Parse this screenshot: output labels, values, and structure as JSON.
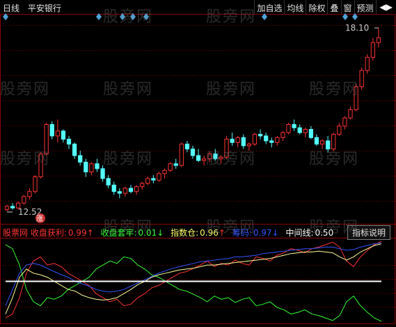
{
  "header": {
    "period": "日线",
    "stock_name": "平安银行"
  },
  "toolbar": {
    "buttons": [
      "加自选",
      "均线",
      "除权",
      "叠",
      "窗",
      "预测"
    ],
    "nav_icon": "◀▶"
  },
  "price_labels": {
    "high": "18.10",
    "low": "12.52",
    "rise_badge": "涨"
  },
  "indicator": {
    "prefix": "股票网 收盘获利:",
    "profit_value": "0.99",
    "profit_arrow": "↑",
    "trap_label": "收盘套牢:",
    "trap_value": "0.01",
    "trap_arrow": "↓",
    "index_label": "指数仓:",
    "index_value": "0.96",
    "index_arrow": "↑",
    "fund_label": "筹码:",
    "fund_value": "0.97",
    "fund_arrow": "↓",
    "mid_label": "中间线:",
    "mid_value": "0.50",
    "explain_button": "指标说明"
  },
  "watermark_text": "股旁网",
  "colors": {
    "up": "#ff3333",
    "down": "#54ffff",
    "grid": "#8b0000",
    "diamond": "#4fa3d9"
  },
  "chart_data": {
    "type": "candlestick",
    "y_range_main": [
      12.52,
      18.1
    ],
    "y_range_indicator": [
      0,
      1
    ],
    "candles": [
      [
        12.55,
        12.7,
        12.5,
        12.65
      ],
      [
        12.65,
        12.75,
        12.55,
        12.6
      ],
      [
        12.6,
        12.8,
        12.55,
        12.75
      ],
      [
        12.75,
        13.0,
        12.7,
        12.95
      ],
      [
        12.95,
        13.2,
        12.85,
        13.1
      ],
      [
        13.1,
        13.6,
        13.05,
        13.55
      ],
      [
        13.55,
        14.3,
        13.5,
        14.25
      ],
      [
        14.25,
        15.2,
        14.2,
        15.15
      ],
      [
        15.15,
        15.25,
        14.7,
        14.8
      ],
      [
        14.8,
        15.3,
        14.6,
        14.95
      ],
      [
        14.95,
        15.0,
        14.6,
        14.7
      ],
      [
        14.7,
        14.8,
        14.4,
        14.55
      ],
      [
        14.55,
        14.6,
        14.1,
        14.2
      ],
      [
        14.2,
        14.35,
        13.9,
        14.0
      ],
      [
        14.0,
        14.1,
        13.55,
        13.7
      ],
      [
        13.7,
        14.0,
        13.6,
        13.95
      ],
      [
        13.95,
        14.1,
        13.7,
        13.8
      ],
      [
        13.8,
        13.9,
        13.4,
        13.5
      ],
      [
        13.5,
        13.6,
        13.2,
        13.3
      ],
      [
        13.3,
        13.4,
        13.0,
        13.1
      ],
      [
        13.1,
        13.2,
        12.9,
        13.05
      ],
      [
        13.05,
        13.25,
        12.95,
        13.2
      ],
      [
        13.2,
        13.3,
        13.05,
        13.1
      ],
      [
        13.1,
        13.3,
        13.0,
        13.25
      ],
      [
        13.25,
        13.4,
        13.15,
        13.35
      ],
      [
        13.35,
        13.55,
        13.3,
        13.5
      ],
      [
        13.5,
        13.6,
        13.35,
        13.45
      ],
      [
        13.45,
        13.7,
        13.4,
        13.65
      ],
      [
        13.65,
        13.8,
        13.5,
        13.75
      ],
      [
        13.75,
        14.0,
        13.7,
        13.95
      ],
      [
        13.95,
        14.1,
        13.8,
        13.9
      ],
      [
        13.9,
        14.6,
        13.85,
        14.55
      ],
      [
        14.55,
        14.65,
        14.3,
        14.4
      ],
      [
        14.4,
        14.5,
        14.1,
        14.2
      ],
      [
        14.2,
        14.4,
        14.0,
        14.05
      ],
      [
        14.05,
        14.2,
        13.9,
        14.1
      ],
      [
        14.1,
        14.3,
        14.0,
        14.25
      ],
      [
        14.25,
        14.4,
        14.05,
        14.1
      ],
      [
        14.1,
        14.2,
        13.95,
        14.15
      ],
      [
        14.15,
        14.8,
        14.1,
        14.7
      ],
      [
        14.7,
        14.9,
        14.5,
        14.6
      ],
      [
        14.6,
        14.8,
        14.45,
        14.75
      ],
      [
        14.75,
        14.85,
        14.4,
        14.5
      ],
      [
        14.5,
        14.6,
        14.35,
        14.55
      ],
      [
        14.55,
        14.9,
        14.5,
        14.85
      ],
      [
        14.85,
        15.0,
        14.7,
        14.8
      ],
      [
        14.8,
        14.9,
        14.55,
        14.65
      ],
      [
        14.65,
        14.75,
        14.45,
        14.6
      ],
      [
        14.6,
        14.8,
        14.5,
        14.75
      ],
      [
        14.75,
        14.95,
        14.65,
        14.9
      ],
      [
        14.9,
        15.2,
        14.85,
        15.15
      ],
      [
        15.15,
        15.3,
        14.95,
        15.05
      ],
      [
        15.05,
        15.15,
        14.85,
        14.9
      ],
      [
        14.9,
        15.05,
        14.75,
        15.0
      ],
      [
        15.0,
        15.1,
        14.7,
        14.75
      ],
      [
        14.75,
        14.85,
        14.5,
        14.55
      ],
      [
        14.55,
        14.7,
        14.4,
        14.65
      ],
      [
        14.65,
        14.8,
        14.3,
        14.4
      ],
      [
        14.4,
        14.9,
        14.35,
        14.85
      ],
      [
        14.85,
        15.2,
        14.8,
        15.1
      ],
      [
        15.1,
        15.4,
        15.0,
        15.35
      ],
      [
        15.35,
        15.7,
        15.3,
        15.6
      ],
      [
        15.6,
        16.4,
        15.55,
        16.3
      ],
      [
        16.3,
        16.9,
        16.2,
        16.8
      ],
      [
        16.8,
        17.3,
        16.7,
        17.2
      ],
      [
        17.2,
        17.8,
        17.1,
        17.65
      ],
      [
        17.65,
        18.1,
        17.5,
        17.8
      ]
    ],
    "indicator_series": [
      {
        "name": "收盘获利",
        "values": [
          0.05,
          0.1,
          0.3,
          0.6,
          0.75,
          0.8,
          0.7,
          0.72,
          0.68,
          0.6,
          0.55,
          0.5,
          0.45,
          0.35,
          0.3,
          0.25,
          0.28,
          0.2,
          0.22,
          0.3,
          0.35,
          0.42,
          0.45,
          0.5,
          0.55,
          0.6,
          0.62,
          0.66,
          0.7,
          0.75,
          0.68,
          0.72,
          0.7,
          0.76,
          0.72,
          0.7,
          0.8,
          0.78,
          0.75,
          0.82,
          0.85,
          0.9,
          0.88,
          0.85,
          0.9,
          0.92,
          0.95,
          0.98,
          0.92,
          0.75,
          0.68,
          0.8,
          0.88,
          0.95,
          0.99
        ]
      },
      {
        "name": "收盘套牢",
        "values": [
          0.95,
          0.9,
          0.7,
          0.4,
          0.25,
          0.2,
          0.3,
          0.28,
          0.32,
          0.4,
          0.45,
          0.5,
          0.55,
          0.65,
          0.7,
          0.75,
          0.72,
          0.8,
          0.78,
          0.7,
          0.65,
          0.58,
          0.55,
          0.5,
          0.45,
          0.4,
          0.38,
          0.34,
          0.3,
          0.25,
          0.32,
          0.28,
          0.3,
          0.24,
          0.28,
          0.3,
          0.2,
          0.22,
          0.25,
          0.18,
          0.15,
          0.1,
          0.12,
          0.15,
          0.1,
          0.08,
          0.05,
          0.02,
          0.08,
          0.25,
          0.32,
          0.2,
          0.12,
          0.05,
          0.01
        ]
      },
      {
        "name": "指数仓",
        "values": [
          0.1,
          0.3,
          0.55,
          0.65,
          0.6,
          0.58,
          0.55,
          0.5,
          0.45,
          0.4,
          0.38,
          0.33,
          0.3,
          0.28,
          0.27,
          0.28,
          0.3,
          0.35,
          0.4,
          0.46,
          0.5,
          0.55,
          0.58,
          0.6,
          0.62,
          0.64,
          0.65,
          0.66,
          0.68,
          0.7,
          0.7,
          0.71,
          0.72,
          0.73,
          0.74,
          0.75,
          0.76,
          0.77,
          0.78,
          0.8,
          0.82,
          0.84,
          0.85,
          0.86,
          0.86,
          0.87,
          0.86,
          0.85,
          0.8,
          0.76,
          0.8,
          0.86,
          0.9,
          0.94,
          0.96
        ]
      },
      {
        "name": "筹码",
        "values": [
          0.2,
          0.4,
          0.6,
          0.7,
          0.72,
          0.7,
          0.66,
          0.62,
          0.58,
          0.55,
          0.5,
          0.47,
          0.44,
          0.4,
          0.38,
          0.37,
          0.38,
          0.4,
          0.44,
          0.48,
          0.52,
          0.56,
          0.6,
          0.63,
          0.66,
          0.68,
          0.7,
          0.72,
          0.74,
          0.75,
          0.76,
          0.77,
          0.78,
          0.8,
          0.8,
          0.81,
          0.82,
          0.84,
          0.85,
          0.86,
          0.87,
          0.88,
          0.89,
          0.9,
          0.9,
          0.91,
          0.92,
          0.92,
          0.9,
          0.88,
          0.89,
          0.92,
          0.94,
          0.96,
          0.97
        ]
      },
      {
        "name": "中间线",
        "values": [
          0.5
        ]
      }
    ]
  }
}
